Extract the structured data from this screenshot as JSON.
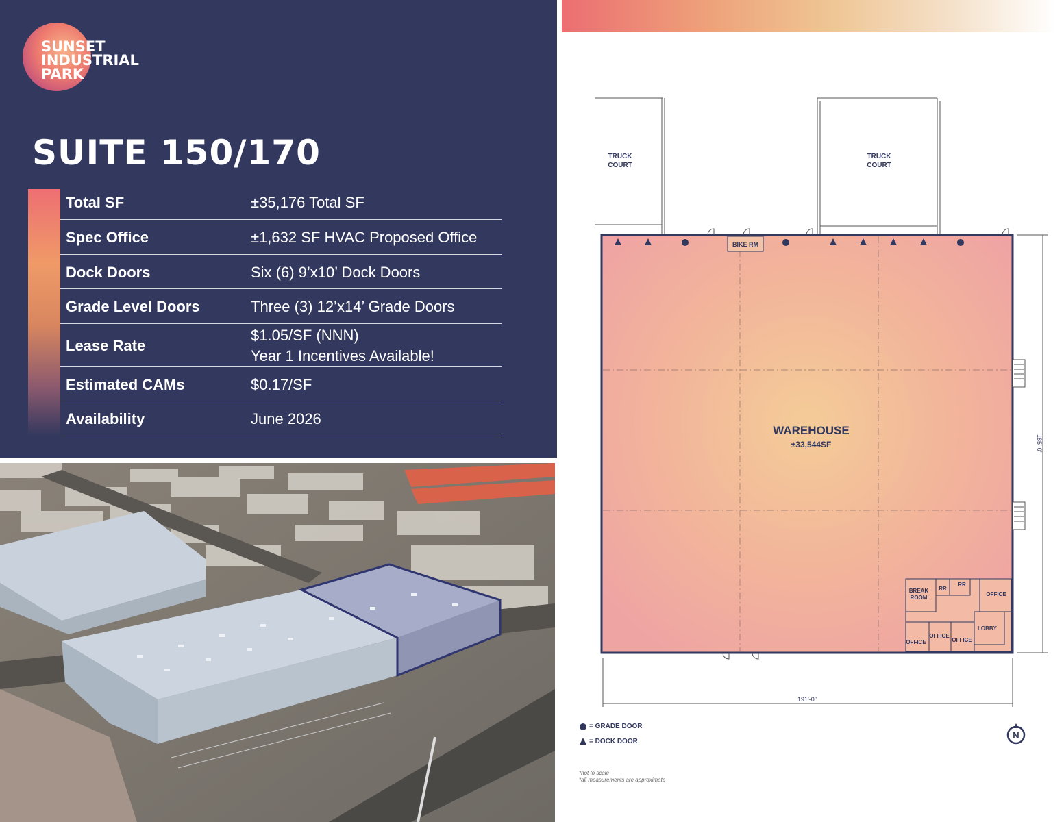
{
  "brand": {
    "logo_lines": [
      "SUNSET",
      "INDUSTRIAL",
      "PARK"
    ]
  },
  "suite_title": "SUITE 150/170",
  "specs": [
    {
      "label": "Total SF",
      "value_lines": [
        "±35,176 Total SF"
      ]
    },
    {
      "label": "Spec Office",
      "value_lines": [
        "±1,632 SF HVAC Proposed Office"
      ]
    },
    {
      "label": "Dock Doors",
      "value_lines": [
        "Six (6) 9’x10’ Dock Doors"
      ]
    },
    {
      "label": "Grade Level Doors",
      "value_lines": [
        "Three (3) 12’x14’ Grade Doors"
      ]
    },
    {
      "label": "Lease Rate",
      "value_lines": [
        "$1.05/SF (NNN)",
        "Year 1 Incentives Available!"
      ]
    },
    {
      "label": "Estimated CAMs",
      "value_lines": [
        "$0.17/SF"
      ]
    },
    {
      "label": "Availability",
      "value_lines": [
        "June 2026"
      ]
    }
  ],
  "floor_plan": {
    "truck_court_left": [
      "TRUCK",
      "COURT"
    ],
    "truck_court_right": [
      "TRUCK",
      "COURT"
    ],
    "bike_room": "BIKE RM",
    "warehouse_label": "WAREHOUSE",
    "warehouse_sf": "±33,544SF",
    "width_dim": "191'-0\"",
    "height_dim": "185'-0\"",
    "rooms": {
      "break_room": [
        "BREAK",
        "ROOM"
      ],
      "rr_1": "RR",
      "rr_2": "RR",
      "office_right": "OFFICE",
      "lobby": "LOBBY",
      "office_bottom_left": "OFFICE",
      "office_mid": "OFFICE",
      "office_bottom_right": "OFFICE"
    },
    "north_symbol": "N"
  },
  "legend": {
    "grade_door": "= GRADE DOOR",
    "dock_door": "= DOCK DOOR"
  },
  "footnotes": [
    "*not to scale",
    "*all measurements are approximate"
  ],
  "colors": {
    "navy": "#33385e",
    "coral": "#ee6f73",
    "peach": "#efc695"
  }
}
